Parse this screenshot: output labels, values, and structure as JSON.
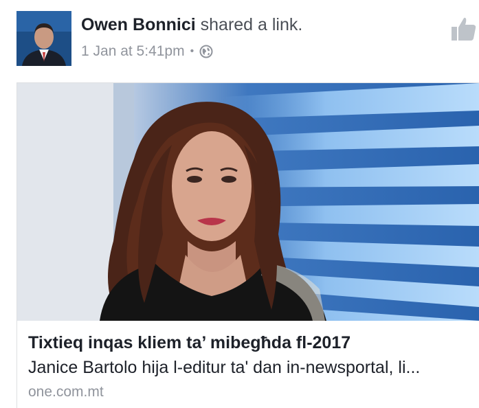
{
  "post": {
    "author": "Owen Bonnici",
    "action": "shared a link.",
    "timestamp": "1 Jan at 5:41pm",
    "separator": "•",
    "privacy_icon": "globe-icon",
    "like_icon": "thumbs-up-icon"
  },
  "link": {
    "title": "Tixtieq inqas kliem ta’ mibegħda fl-2017",
    "description": "Janice Bartolo hija l-editur ta' dan in-newsportal, li...",
    "domain": "one.com.mt"
  },
  "colors": {
    "name": "#1d2129",
    "meta": "#90949c",
    "like_icon": "#bec3c9",
    "card_border": "#dddfe2"
  }
}
